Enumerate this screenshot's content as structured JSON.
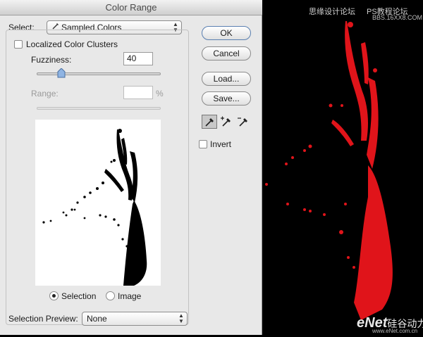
{
  "dialog": {
    "title": "Color Range",
    "select_label": "Select:",
    "select_value": "Sampled Colors",
    "localized_clusters_label": "Localized Color Clusters",
    "fuzziness_label": "Fuzziness:",
    "fuzziness_value": "40",
    "fuzziness_slider_fraction": 0.2,
    "range_label": "Range:",
    "range_value": "",
    "range_unit": "%",
    "selection_label": "Selection",
    "image_label": "Image",
    "selection_preview_label": "Selection Preview:",
    "selection_preview_value": "None",
    "buttons": {
      "ok": "OK",
      "cancel": "Cancel",
      "load": "Load...",
      "save": "Save..."
    },
    "invert_label": "Invert"
  },
  "watermarks": {
    "top_line1": "思缘设计论坛",
    "top_line2": "PS教程论坛",
    "top_line3": "BBS.16XX8.COM",
    "bottom": "eNet",
    "bottom_suffix": "硅谷动力",
    "bottom_url": "www.eNet.com.cn"
  },
  "colors": {
    "splash": "#e0141a",
    "background": "#000000",
    "dialog": "#e8e8e8"
  }
}
